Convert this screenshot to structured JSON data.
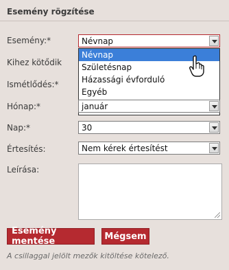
{
  "header": {
    "title": "Esemény rögzítése"
  },
  "form": {
    "event": {
      "label": "Esemény:*",
      "value": "Névnap"
    },
    "related": {
      "label": "Kihez kötődik"
    },
    "recurrence": {
      "label": "Ismétlődés:*"
    },
    "month": {
      "label": "Hónap:*",
      "value": "január"
    },
    "day": {
      "label": "Nap:*",
      "value": "30"
    },
    "notification": {
      "label": "Értesítés:",
      "value": "Nem kérek értesítést"
    },
    "description": {
      "label": "Leírása:"
    }
  },
  "dropdown": {
    "options": [
      "Névnap",
      "Születésnap",
      "Házassági évforduló",
      "Egyéb"
    ],
    "selected": "Névnap"
  },
  "buttons": {
    "save": "Esemény mentése",
    "cancel": "Mégsem"
  },
  "footnote": "A csillaggal jelölt mezők kitöltése kötelező.",
  "colors": {
    "background": "#e7e0dc",
    "accent": "#b52a30",
    "selection": "#3b7fd9"
  }
}
